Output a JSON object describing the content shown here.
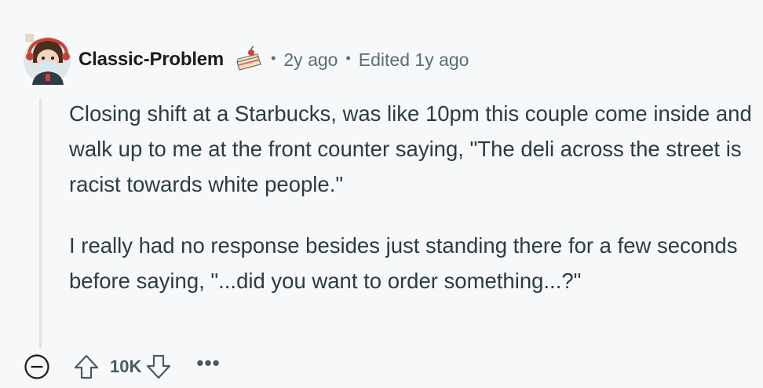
{
  "comment": {
    "username": "Classic-Problem",
    "age": "2y ago",
    "edited": "Edited 1y ago",
    "paragraphs": [
      "Closing shift at a Starbucks, was like 10pm this couple come inside and walk up to me at the front counter saying, \"The deli across the street is racist towards white people.\"",
      "I really had no response besides just standing there for a few seconds before saying, \"...did you want to order something...?\""
    ],
    "score": "10K",
    "separator": "•",
    "more_label": "•••"
  },
  "icons": {
    "avatar": "avatar-icon",
    "flair": "cake-icon",
    "collapse": "minus-circle-icon",
    "upvote": "arrow-up-icon",
    "downvote": "arrow-down-icon",
    "more": "more-icon"
  }
}
